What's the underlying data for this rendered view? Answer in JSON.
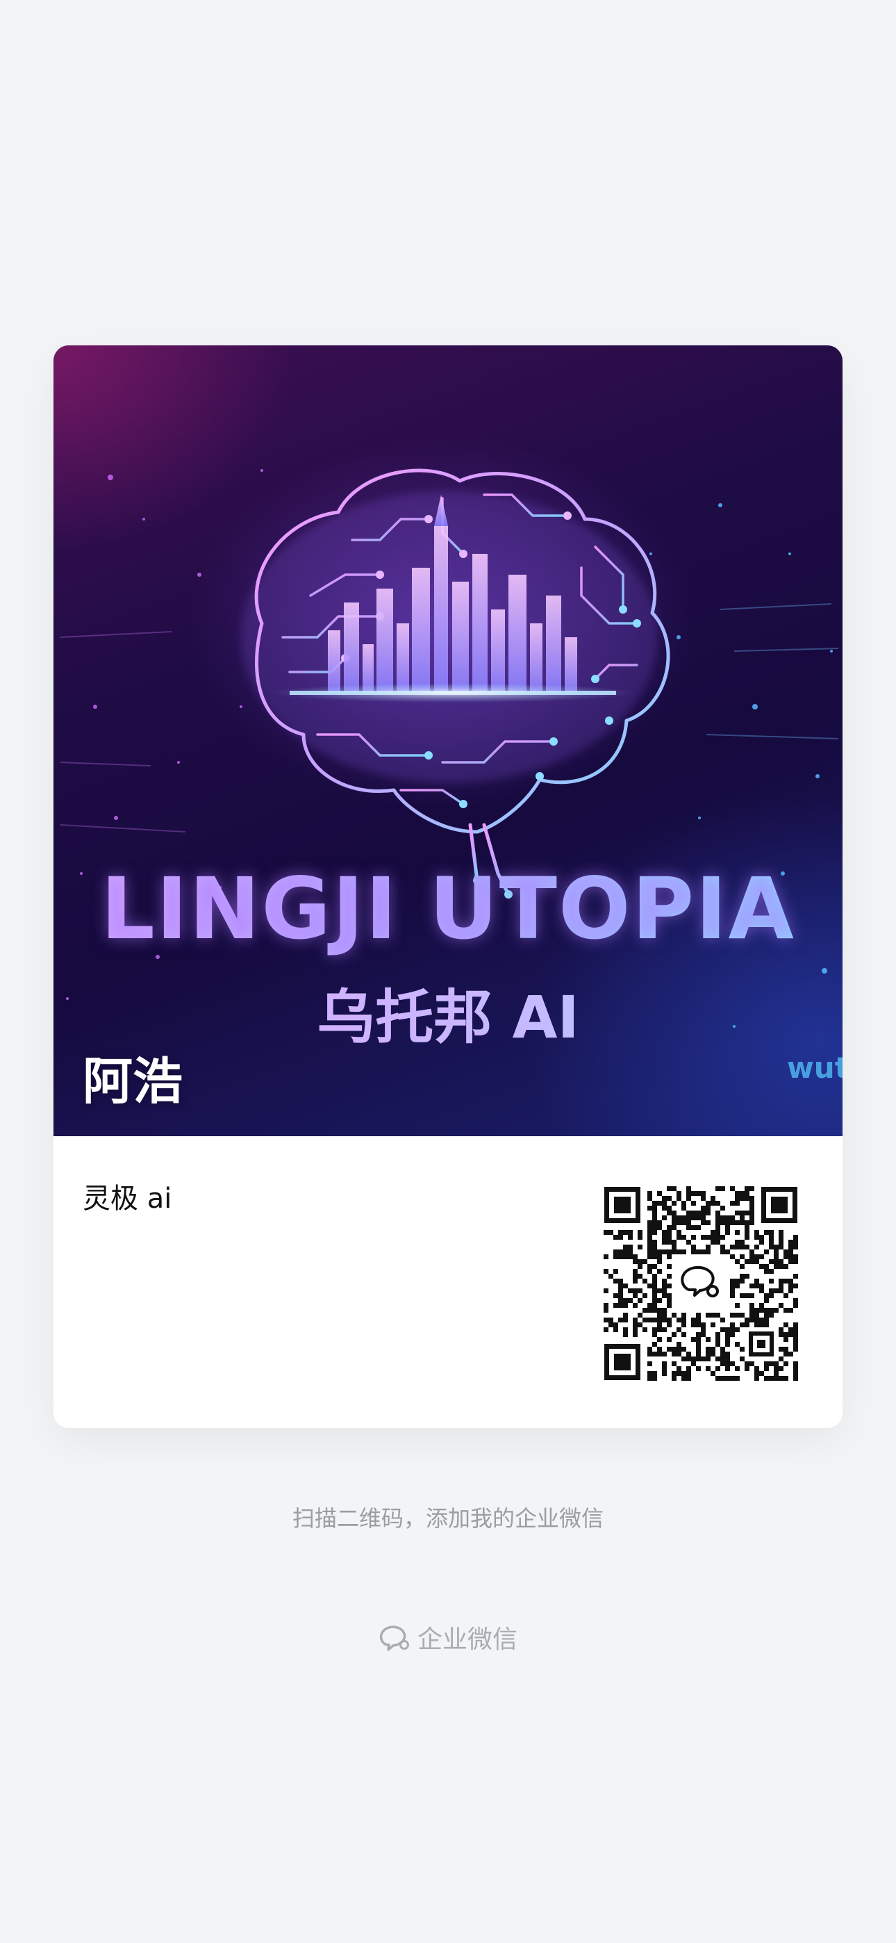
{
  "card": {
    "cover": {
      "title": "LINGJI UTOPIA",
      "subtitle": "乌托邦 AI",
      "edge_text": "wut"
    },
    "user_name": "阿浩",
    "company": "灵极 ai",
    "qr_icon": "wecom-icon"
  },
  "scan_hint": "扫描二维码，添加我的企业微信",
  "footer": {
    "brand_icon": "wecom-icon",
    "brand_label": "企业微信"
  },
  "colors": {
    "page_background": "#f2f4f6",
    "card_background": "#ffffff",
    "hint_text": "#9a9ea3"
  }
}
